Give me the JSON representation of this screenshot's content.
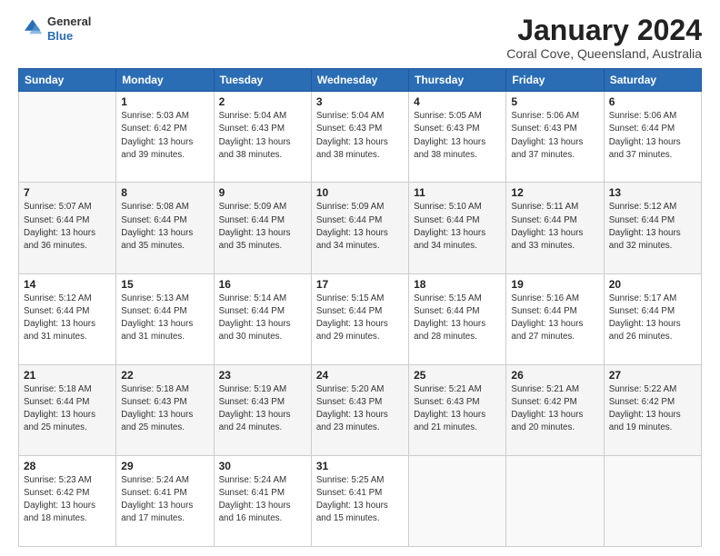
{
  "logo": {
    "general": "General",
    "blue": "Blue"
  },
  "header": {
    "month": "January 2024",
    "location": "Coral Cove, Queensland, Australia"
  },
  "days_of_week": [
    "Sunday",
    "Monday",
    "Tuesday",
    "Wednesday",
    "Thursday",
    "Friday",
    "Saturday"
  ],
  "weeks": [
    [
      {
        "day": "",
        "info": ""
      },
      {
        "day": "1",
        "info": "Sunrise: 5:03 AM\nSunset: 6:42 PM\nDaylight: 13 hours\nand 39 minutes."
      },
      {
        "day": "2",
        "info": "Sunrise: 5:04 AM\nSunset: 6:43 PM\nDaylight: 13 hours\nand 38 minutes."
      },
      {
        "day": "3",
        "info": "Sunrise: 5:04 AM\nSunset: 6:43 PM\nDaylight: 13 hours\nand 38 minutes."
      },
      {
        "day": "4",
        "info": "Sunrise: 5:05 AM\nSunset: 6:43 PM\nDaylight: 13 hours\nand 38 minutes."
      },
      {
        "day": "5",
        "info": "Sunrise: 5:06 AM\nSunset: 6:43 PM\nDaylight: 13 hours\nand 37 minutes."
      },
      {
        "day": "6",
        "info": "Sunrise: 5:06 AM\nSunset: 6:44 PM\nDaylight: 13 hours\nand 37 minutes."
      }
    ],
    [
      {
        "day": "7",
        "info": "Sunrise: 5:07 AM\nSunset: 6:44 PM\nDaylight: 13 hours\nand 36 minutes."
      },
      {
        "day": "8",
        "info": "Sunrise: 5:08 AM\nSunset: 6:44 PM\nDaylight: 13 hours\nand 35 minutes."
      },
      {
        "day": "9",
        "info": "Sunrise: 5:09 AM\nSunset: 6:44 PM\nDaylight: 13 hours\nand 35 minutes."
      },
      {
        "day": "10",
        "info": "Sunrise: 5:09 AM\nSunset: 6:44 PM\nDaylight: 13 hours\nand 34 minutes."
      },
      {
        "day": "11",
        "info": "Sunrise: 5:10 AM\nSunset: 6:44 PM\nDaylight: 13 hours\nand 34 minutes."
      },
      {
        "day": "12",
        "info": "Sunrise: 5:11 AM\nSunset: 6:44 PM\nDaylight: 13 hours\nand 33 minutes."
      },
      {
        "day": "13",
        "info": "Sunrise: 5:12 AM\nSunset: 6:44 PM\nDaylight: 13 hours\nand 32 minutes."
      }
    ],
    [
      {
        "day": "14",
        "info": "Sunrise: 5:12 AM\nSunset: 6:44 PM\nDaylight: 13 hours\nand 31 minutes."
      },
      {
        "day": "15",
        "info": "Sunrise: 5:13 AM\nSunset: 6:44 PM\nDaylight: 13 hours\nand 31 minutes."
      },
      {
        "day": "16",
        "info": "Sunrise: 5:14 AM\nSunset: 6:44 PM\nDaylight: 13 hours\nand 30 minutes."
      },
      {
        "day": "17",
        "info": "Sunrise: 5:15 AM\nSunset: 6:44 PM\nDaylight: 13 hours\nand 29 minutes."
      },
      {
        "day": "18",
        "info": "Sunrise: 5:15 AM\nSunset: 6:44 PM\nDaylight: 13 hours\nand 28 minutes."
      },
      {
        "day": "19",
        "info": "Sunrise: 5:16 AM\nSunset: 6:44 PM\nDaylight: 13 hours\nand 27 minutes."
      },
      {
        "day": "20",
        "info": "Sunrise: 5:17 AM\nSunset: 6:44 PM\nDaylight: 13 hours\nand 26 minutes."
      }
    ],
    [
      {
        "day": "21",
        "info": "Sunrise: 5:18 AM\nSunset: 6:44 PM\nDaylight: 13 hours\nand 25 minutes."
      },
      {
        "day": "22",
        "info": "Sunrise: 5:18 AM\nSunset: 6:43 PM\nDaylight: 13 hours\nand 25 minutes."
      },
      {
        "day": "23",
        "info": "Sunrise: 5:19 AM\nSunset: 6:43 PM\nDaylight: 13 hours\nand 24 minutes."
      },
      {
        "day": "24",
        "info": "Sunrise: 5:20 AM\nSunset: 6:43 PM\nDaylight: 13 hours\nand 23 minutes."
      },
      {
        "day": "25",
        "info": "Sunrise: 5:21 AM\nSunset: 6:43 PM\nDaylight: 13 hours\nand 21 minutes."
      },
      {
        "day": "26",
        "info": "Sunrise: 5:21 AM\nSunset: 6:42 PM\nDaylight: 13 hours\nand 20 minutes."
      },
      {
        "day": "27",
        "info": "Sunrise: 5:22 AM\nSunset: 6:42 PM\nDaylight: 13 hours\nand 19 minutes."
      }
    ],
    [
      {
        "day": "28",
        "info": "Sunrise: 5:23 AM\nSunset: 6:42 PM\nDaylight: 13 hours\nand 18 minutes."
      },
      {
        "day": "29",
        "info": "Sunrise: 5:24 AM\nSunset: 6:41 PM\nDaylight: 13 hours\nand 17 minutes."
      },
      {
        "day": "30",
        "info": "Sunrise: 5:24 AM\nSunset: 6:41 PM\nDaylight: 13 hours\nand 16 minutes."
      },
      {
        "day": "31",
        "info": "Sunrise: 5:25 AM\nSunset: 6:41 PM\nDaylight: 13 hours\nand 15 minutes."
      },
      {
        "day": "",
        "info": ""
      },
      {
        "day": "",
        "info": ""
      },
      {
        "day": "",
        "info": ""
      }
    ]
  ]
}
